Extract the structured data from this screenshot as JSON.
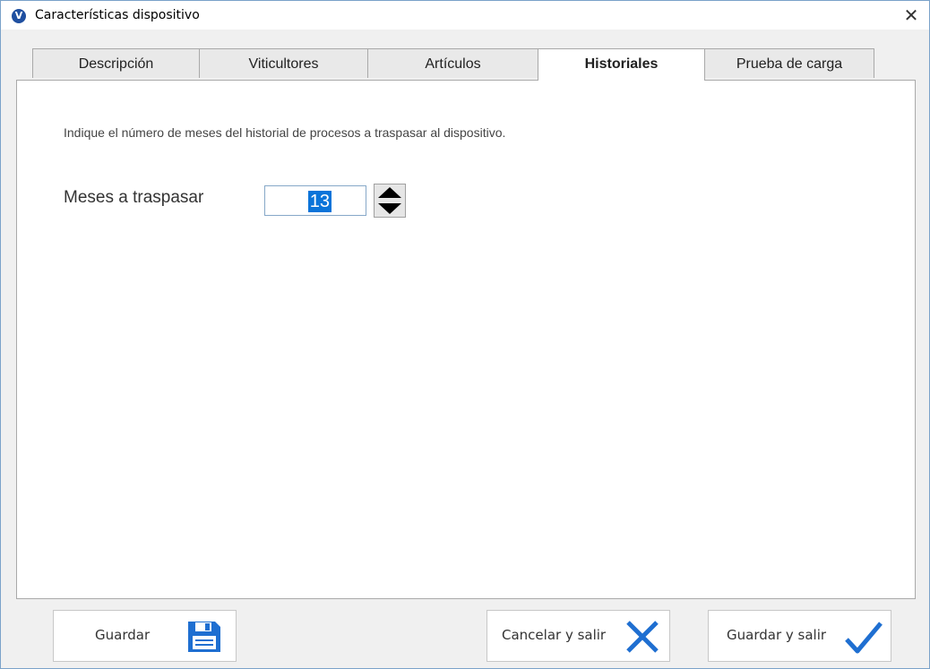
{
  "window": {
    "title": "Características dispositivo",
    "app_icon": "V"
  },
  "tabs": [
    {
      "label": "Descripción"
    },
    {
      "label": "Viticultores"
    },
    {
      "label": "Artículos"
    },
    {
      "label": "Historiales",
      "active": true
    },
    {
      "label": "Prueba de carga"
    }
  ],
  "historiales": {
    "instruction": "Indique el número de meses del historial de procesos a traspasar al dispositivo.",
    "meses_label": "Meses a traspasar",
    "meses_value": "13"
  },
  "buttons": {
    "guardar": "Guardar",
    "cancelar_salir": "Cancelar y salir",
    "guardar_salir": "Guardar y salir"
  },
  "icons": {
    "save": "floppy-disk-icon",
    "cancel": "x-icon",
    "confirm": "checkmark-icon",
    "close": "close-icon"
  },
  "colors": {
    "accent": "#1f6fd1",
    "selection": "#0a74d9"
  }
}
